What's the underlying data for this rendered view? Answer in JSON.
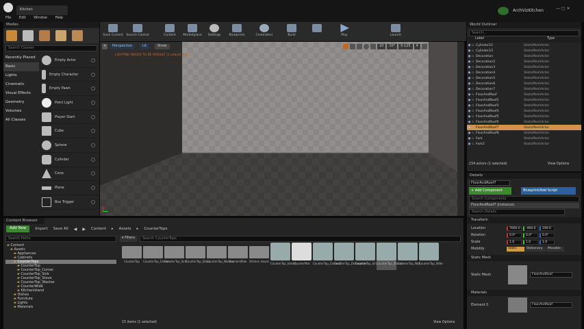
{
  "window": {
    "project_title": "ArchVizKitchen",
    "tab_title": "Kitchen"
  },
  "menu": [
    "File",
    "Edit",
    "Window",
    "Help"
  ],
  "modes": {
    "title": "Modes",
    "search_placeholder": "Search Classes",
    "categories": [
      "Recently Placed",
      "Basic",
      "Lights",
      "Cinematic",
      "Visual Effects",
      "Geometry",
      "Volumes",
      "All Classes"
    ],
    "items": [
      "Empty Actor",
      "Empty Character",
      "Empty Pawn",
      "Point Light",
      "Player Start",
      "Cube",
      "Sphere",
      "Cylinder",
      "Cone",
      "Plane",
      "Box Trigger"
    ]
  },
  "toolbar": [
    "Save Current",
    "Source Control",
    "Content",
    "Marketplace",
    "Settings",
    "Blueprints",
    "Cinematics",
    "Build",
    "Play",
    "Launch"
  ],
  "viewport": {
    "perspective_label": "Perspective",
    "lit_label": "Lit",
    "show_label": "Show",
    "lighting_warning": "LIGHTING NEEDS TO BE REBUILT (1 unbuilt object)",
    "grid_snap": "10",
    "rot_snap": "10°",
    "scale_snap": "0.125",
    "camera_speed": "4"
  },
  "outliner": {
    "title": "World Outliner",
    "search_placeholder": "Search...",
    "col_label": "Label",
    "col_type": "Type",
    "rows": [
      {
        "name": "Cylinder22",
        "type": "StaticMeshActor"
      },
      {
        "name": "Cylinder23",
        "type": "StaticMeshActor"
      },
      {
        "name": "Decoration",
        "type": "StaticMeshActor"
      },
      {
        "name": "Decoration2",
        "type": "StaticMeshActor"
      },
      {
        "name": "Decoration3",
        "type": "StaticMeshActor"
      },
      {
        "name": "Decoration4",
        "type": "StaticMeshActor"
      },
      {
        "name": "Decoration5",
        "type": "StaticMeshActor"
      },
      {
        "name": "Decoration6",
        "type": "StaticMeshActor"
      },
      {
        "name": "Decoration7",
        "type": "StaticMeshActor"
      },
      {
        "name": "FloorAndRoof",
        "type": "StaticMeshActor"
      },
      {
        "name": "FloorAndRoof2",
        "type": "StaticMeshActor"
      },
      {
        "name": "FloorAndRoof3",
        "type": "StaticMeshActor"
      },
      {
        "name": "FloorAndRoof4",
        "type": "StaticMeshActor"
      },
      {
        "name": "FloorAndRoof5",
        "type": "StaticMeshActor"
      },
      {
        "name": "FloorAndRoof6",
        "type": "StaticMeshActor"
      },
      {
        "name": "FloorAndRoof7",
        "type": "StaticMeshActor"
      },
      {
        "name": "FloorAndRoof8",
        "type": "StaticMeshActor"
      },
      {
        "name": "Fork",
        "type": "StaticMeshActor"
      },
      {
        "name": "Fork2",
        "type": "StaticMeshActor"
      }
    ],
    "selected_index": 15,
    "footer": "234 actors (1 selected)",
    "view_options": "View Options"
  },
  "details": {
    "tab": "Details",
    "actor_name": "FloorAndRoof7",
    "add_component": "+ Add Component",
    "blueprint_script": "Blueprint/Add Script",
    "search_components": "Search Components",
    "instance_label": "FloorAndRoof7 (Instance)",
    "search_details": "Search Details",
    "transform": "Transform",
    "location_label": "Location",
    "location": [
      "7660.0",
      "-460.0",
      "190.0"
    ],
    "rotation_label": "Rotation",
    "rotation": [
      "0.0°",
      "0.0°",
      "0.0°"
    ],
    "scale_label": "Scale",
    "scale": [
      "1.0",
      "1.0",
      "1.0"
    ],
    "mobility_label": "Mobility",
    "mobility": [
      "Static",
      "Stationary",
      "Movable"
    ],
    "static_mesh_section": "Static Mesh",
    "static_mesh_label": "Static Mesh",
    "static_mesh_value": "FloorAndRoof",
    "materials_section": "Materials",
    "element_label": "Element 0",
    "element_value": "FloorAndRoof"
  },
  "content_browser": {
    "tab": "Content Browser",
    "add_new": "Add New",
    "import": "Import",
    "save_all": "Save All",
    "breadcrumb": [
      "Content",
      "Assets",
      "CounterTops"
    ],
    "search_paths": "Search Paths",
    "filters": "Filters",
    "search_assets": "Search CounterTops",
    "tree": [
      "Content",
      "Assets",
      "Appliances",
      "Cabinets",
      "CounterTops",
      "CounterTop",
      "CounterTop_Corner",
      "CounterTop_Sink",
      "CounterTop_Stove",
      "CounterTop_Washer",
      "CounterWide",
      "KitchenIsland",
      "Dishes",
      "Furniture",
      "Lights",
      "Materials"
    ],
    "assets": [
      {
        "label": "CounterTop",
        "folder": true
      },
      {
        "label": "CounterTop_Corner",
        "folder": true
      },
      {
        "label": "CounterTop_Sink",
        "folder": true
      },
      {
        "label": "CounterTop_Stove",
        "folder": true
      },
      {
        "label": "CounterTop_Washer",
        "folder": true
      },
      {
        "label": "CounterWide",
        "folder": true
      },
      {
        "label": "Kitchen Island",
        "folder": true
      },
      {
        "label": "CounterTop_Island",
        "folder": false
      },
      {
        "label": "CounterMat",
        "folder": false
      },
      {
        "label": "CounterTop_Corner2",
        "folder": false
      },
      {
        "label": "CounterTop_Dishwasher",
        "folder": false
      },
      {
        "label": "CounterTop_Sink",
        "folder": false
      },
      {
        "label": "CounterTop_Stove2",
        "folder": false
      },
      {
        "label": "CounterTop_Wall",
        "folder": false
      },
      {
        "label": "CounterTop_Wide",
        "folder": false
      }
    ],
    "selected_asset": 12,
    "footer": "15 items (1 selected)",
    "view_options": "View Options"
  }
}
